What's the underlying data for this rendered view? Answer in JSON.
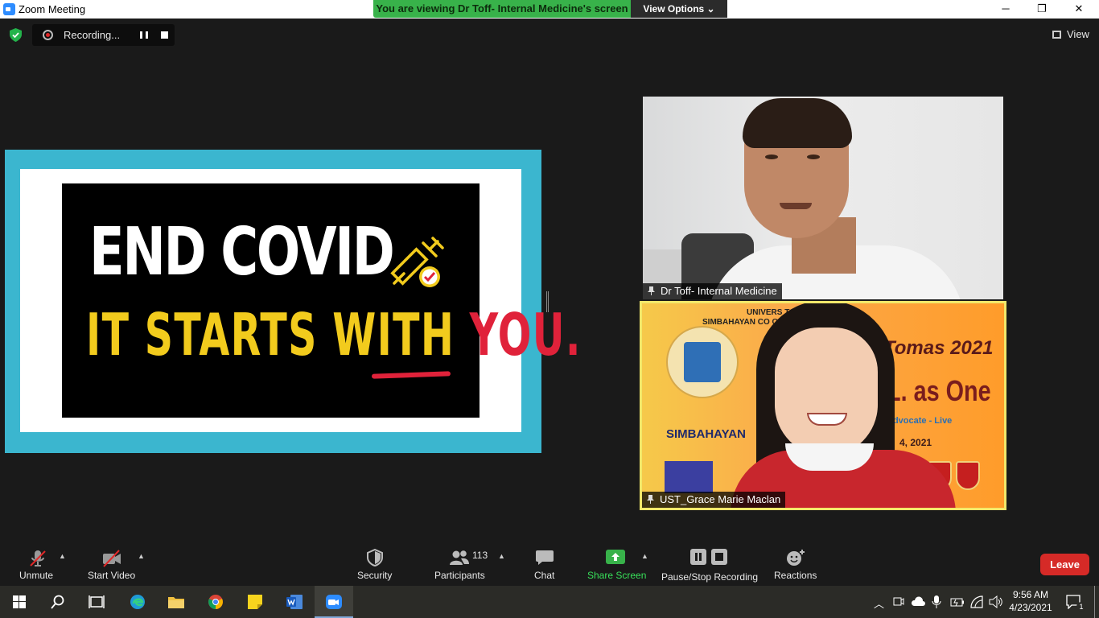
{
  "window": {
    "title": "Zoom Meeting",
    "minimize": "─",
    "restore": "❐",
    "close": "✕"
  },
  "banner": {
    "message": "You are viewing Dr Toff- Internal Medicine's screen",
    "view_options": "View Options ⌄"
  },
  "recording": {
    "label": "Recording..."
  },
  "view_button": {
    "label": "View"
  },
  "shared_screen": {
    "line1": "END COVID",
    "line2_prefix": "IT STARTS WITH ",
    "line2_highlight": "YOU."
  },
  "participants_tiles": [
    {
      "name": "Dr Toff- Internal Medicine"
    },
    {
      "name": "UST_Grace Marie Maclan",
      "background_text": {
        "header1": "UNIVERS                         TOMAS",
        "header2": "SIMBAHAYAN CO                     OPMENT OFFICE",
        "year": "Tomas 2021",
        "tagline": "L. as One",
        "advocate": "Advocate - Live",
        "date": "4, 2021",
        "logo_text": "SIMBAHAYAN"
      }
    }
  ],
  "toolbar": {
    "unmute": "Unmute",
    "start_video": "Start Video",
    "security": "Security",
    "participants": "Participants",
    "participant_count": "113",
    "chat": "Chat",
    "share_screen": "Share Screen",
    "pause_stop_recording": "Pause/Stop Recording",
    "reactions": "Reactions",
    "leave": "Leave"
  },
  "taskbar": {
    "time": "9:56 AM",
    "date": "4/23/2021",
    "notification_count": "1"
  },
  "colors": {
    "share_green": "#38b24a",
    "leave_red": "#d62a27",
    "slide_border": "#3bb6cf",
    "active_speaker": "#f2e86a"
  }
}
